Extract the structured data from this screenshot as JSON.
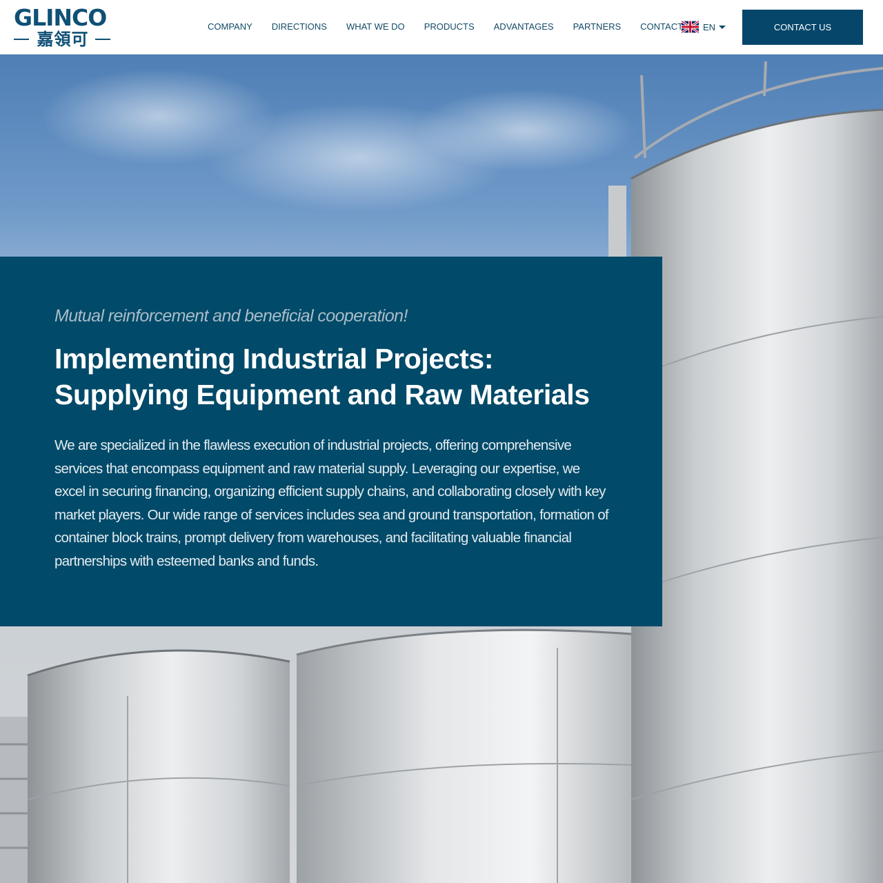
{
  "header": {
    "logo": {
      "latin": "GLINCO",
      "cjk": "嘉領可"
    },
    "nav": [
      {
        "label": "COMPANY"
      },
      {
        "label": "DIRECTIONS"
      },
      {
        "label": "WHAT WE DO"
      },
      {
        "label": "PRODUCTS"
      },
      {
        "label": "ADVANTAGES"
      },
      {
        "label": "PARTNERS"
      },
      {
        "label": "CONTACTS"
      }
    ],
    "language": {
      "selected": "EN",
      "flag_icon": "uk-flag-icon"
    },
    "cta_label": "CONTACT US"
  },
  "hero": {
    "tagline": "Mutual reinforcement and beneficial cooperation!",
    "headline": "Implementing Industrial Projects: Supplying Equipment and Raw Materials",
    "body": "We are specialized in the flawless execution of industrial projects, offering comprehensive services that encompass equipment and raw material supply. Leveraging our expertise, we excel in securing financing, organizing efficient supply chains, and collaborating closely with key market players. Our wide range of services includes sea and ground transportation, formation of container block trains, prompt delivery from warehouses, and facilitating valuable financial partnerships with esteemed banks and funds."
  },
  "colors": {
    "brand": "#0f5076",
    "panel": "#024a69",
    "cta": "#06466a",
    "nav_text": "#114a66"
  }
}
